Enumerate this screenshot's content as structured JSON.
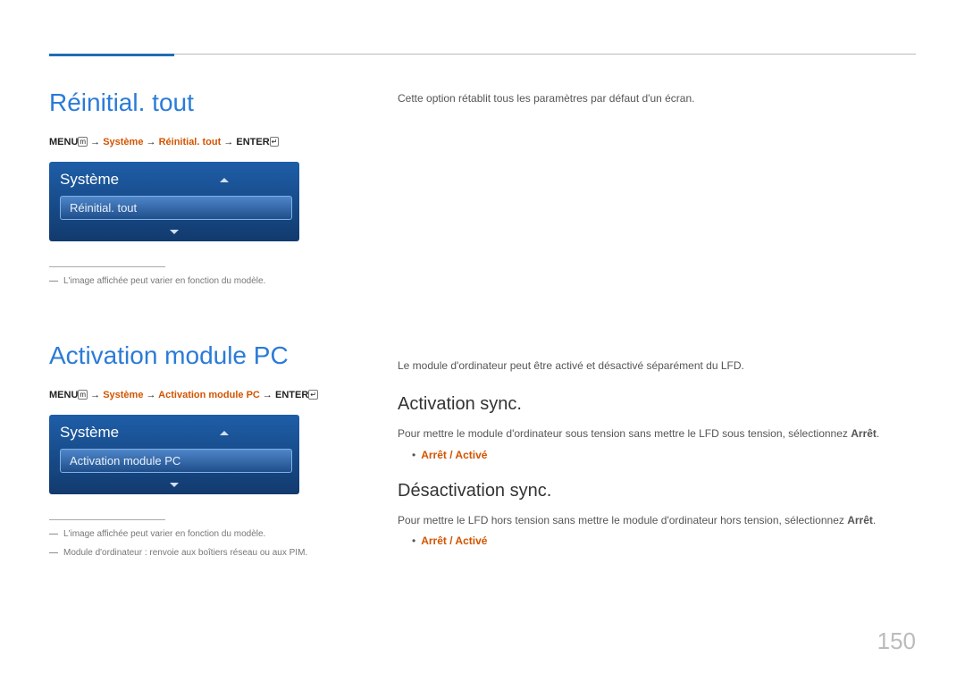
{
  "section1": {
    "title": "Réinitial. tout",
    "breadcrumb": {
      "menu": "MENU",
      "arrow": "→",
      "p1": "Système",
      "p2": "Réinitial. tout",
      "p3": "ENTER"
    },
    "panel": {
      "header": "Système",
      "item": "Réinitial. tout"
    },
    "note1": "L'image affichée peut varier en fonction du modèle.",
    "desc": "Cette option rétablit tous les paramètres par défaut d'un écran."
  },
  "section2": {
    "title": "Activation module PC",
    "breadcrumb": {
      "menu": "MENU",
      "arrow": "→",
      "p1": "Système",
      "p2": "Activation module PC",
      "p3": "ENTER"
    },
    "panel": {
      "header": "Système",
      "item": "Activation module PC"
    },
    "note1": "L'image affichée peut varier en fonction du modèle.",
    "note2": "Module d'ordinateur : renvoie aux boîtiers réseau ou aux PIM.",
    "desc": "Le module d'ordinateur peut être activé et désactivé séparément du LFD.",
    "sub1": {
      "title": "Activation sync.",
      "text_a": "Pour mettre le module d'ordinateur sous tension sans mettre le LFD sous tension, sélectionnez ",
      "text_b": "Arrêt",
      "text_c": ".",
      "opts": "Arrêt / Activé"
    },
    "sub2": {
      "title": "Désactivation sync.",
      "text_a": "Pour mettre le LFD hors tension sans mettre le module d'ordinateur hors tension, sélectionnez ",
      "text_b": "Arrêt",
      "text_c": ".",
      "opts": "Arrêt / Activé"
    }
  },
  "page_number": "150"
}
